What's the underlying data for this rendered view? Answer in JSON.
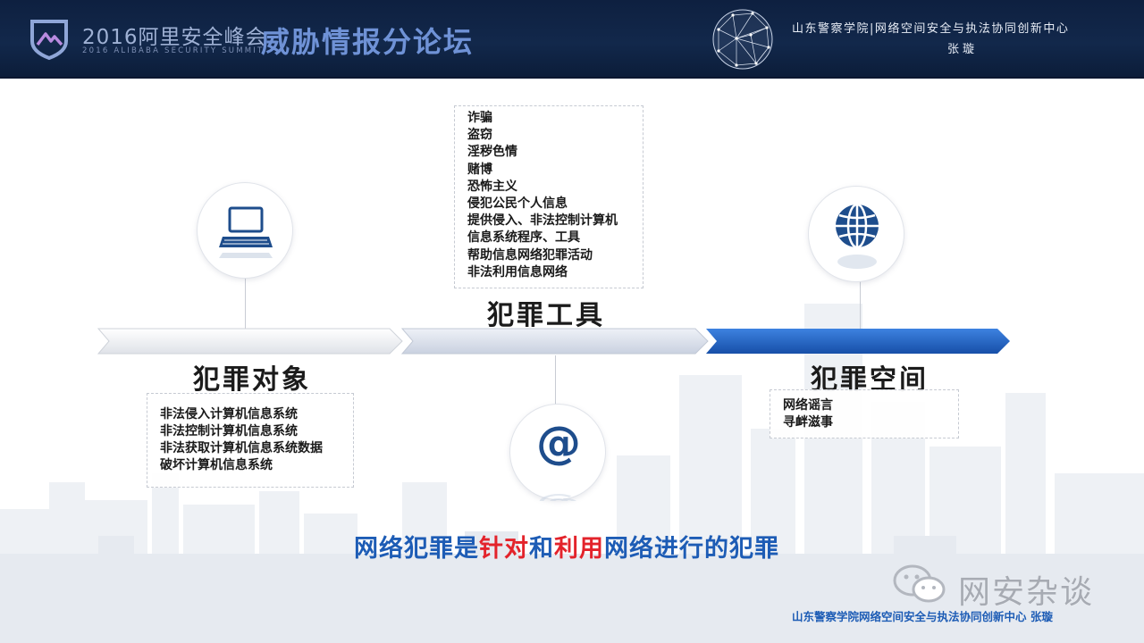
{
  "header": {
    "summit_title": "2016阿里安全峰会",
    "summit_subtitle": "2016 ALIBABA SECURITY SUMMIT",
    "forum_title": "威胁情报分论坛",
    "organization": "山东警察学院|网络空间安全与执法协同创新中心",
    "author": "张璇"
  },
  "sections": [
    {
      "title": "犯罪对象",
      "icon": "laptop-icon",
      "items": [
        "非法侵入计算机信息系统",
        "非法控制计算机信息系统",
        "非法获取计算机信息系统数据",
        "破坏计算机信息系统"
      ]
    },
    {
      "title": "犯罪工具",
      "icon": "at-sign-icon",
      "items": [
        "诈骗",
        "盗窃",
        "淫秽色情",
        "赌博",
        "恐怖主义",
        "侵犯公民个人信息",
        "提供侵入、非法控制计算机",
        "信息系统程序、工具",
        "帮助信息网络犯罪活动",
        "非法利用信息网络"
      ]
    },
    {
      "title": "犯罪空间",
      "icon": "globe-icon",
      "items": [
        "网络谣言",
        "寻衅滋事"
      ]
    }
  ],
  "slogan": {
    "part1": "网络犯罪是",
    "part2": "针对",
    "part3": "和",
    "part4": "利用",
    "part5": "网络进行的犯罪"
  },
  "watermark": "网安杂谈",
  "footer": "山东警察学院网络空间安全与执法协同创新中心  张璇",
  "colors": {
    "header_bg": "#12284b",
    "accent_blue": "#1d5cb5",
    "accent_red": "#e3232b",
    "arrow_active": "#1f63c6"
  }
}
